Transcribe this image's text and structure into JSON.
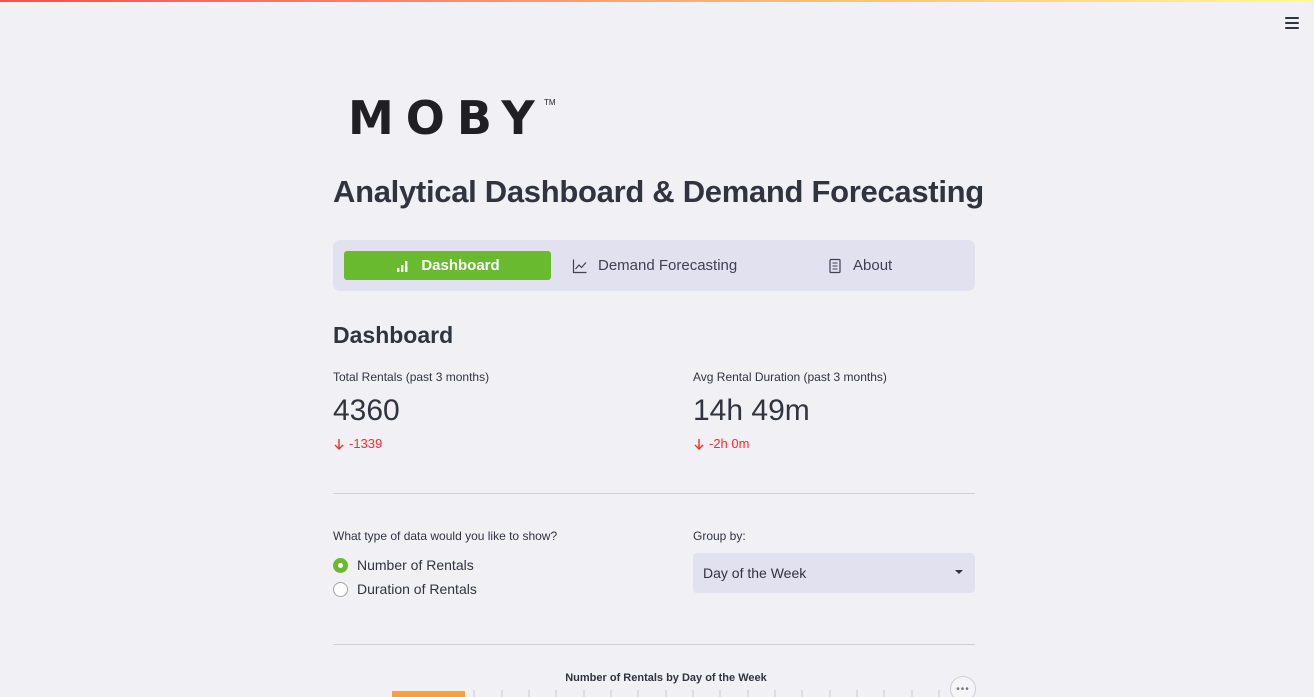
{
  "brand": {
    "name": "MOBY",
    "trademark": "TM"
  },
  "app_title": "Analytical Dashboard & Demand Forecasting",
  "nav": {
    "items": [
      {
        "label": "Dashboard",
        "icon": "bar-chart-icon",
        "active": true
      },
      {
        "label": "Demand Forecasting",
        "icon": "line-chart-icon",
        "active": false
      },
      {
        "label": "About",
        "icon": "document-icon",
        "active": false
      }
    ]
  },
  "dashboard": {
    "title": "Dashboard",
    "metrics": [
      {
        "label": "Total Rentals (past 3 months)",
        "value": "4360",
        "delta": "-1339"
      },
      {
        "label": "Avg Rental Duration (past 3 months)",
        "value": "14h 49m",
        "delta": "-2h 0m"
      }
    ],
    "data_type": {
      "label": "What type of data would you like to show?",
      "options": [
        "Number of Rentals",
        "Duration of Rentals"
      ],
      "selected": "Number of Rentals"
    },
    "group_by": {
      "label": "Group by:",
      "value": "Day of the Week"
    },
    "chart": {
      "title": "Number of Rentals by Day of the Week"
    }
  },
  "colors": {
    "accent": "#6aba2f",
    "delta_negative": "#ff2b2b",
    "nav_bg": "#e2e1ef",
    "bar": "#f5a045"
  }
}
